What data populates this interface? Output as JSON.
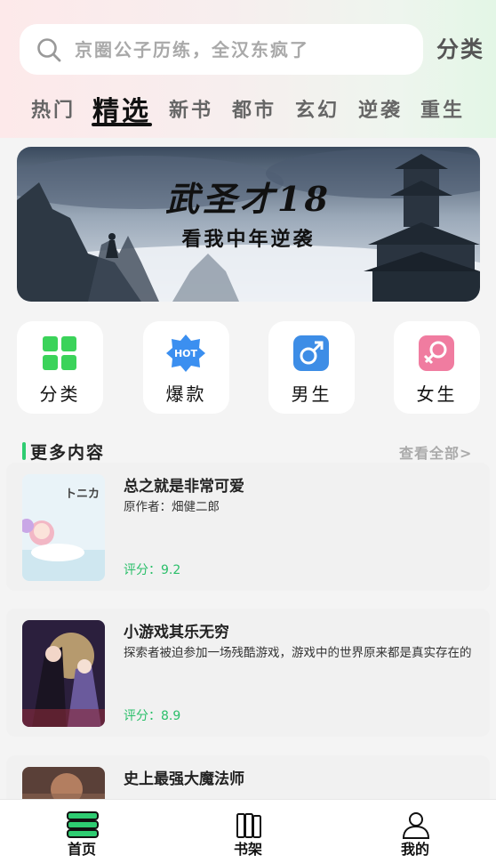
{
  "search": {
    "placeholder": "京圈公子历练，全汉东疯了",
    "category_label": "分类"
  },
  "tabs": [
    {
      "label": "热门"
    },
    {
      "label": "精选"
    },
    {
      "label": "新书"
    },
    {
      "label": "都市"
    },
    {
      "label": "玄幻"
    },
    {
      "label": "逆袭"
    },
    {
      "label": "重生"
    }
  ],
  "banner": {
    "title": "武圣才18",
    "subtitle": "看我中年逆袭"
  },
  "quick_links": [
    {
      "label": "分类",
      "icon": "grid-icon",
      "color": "#3bd35a"
    },
    {
      "label": "爆款",
      "icon": "hot-badge-icon",
      "badge": "HOT",
      "color": "#3b8ff0"
    },
    {
      "label": "男生",
      "icon": "male-icon",
      "color": "#3d8de6"
    },
    {
      "label": "女生",
      "icon": "female-icon",
      "color": "#f07ca0"
    }
  ],
  "section": {
    "title": "更多内容",
    "view_all": "查看全部>"
  },
  "books": [
    {
      "title": "总之就是非常可爱",
      "desc": "原作者：畑健二郎",
      "rating": "评分：9.2"
    },
    {
      "title": "小游戏其乐无穷",
      "desc": "探索者被迫参加一场残酷游戏，游戏中的世界原来都是真实存在的",
      "rating": "评分：8.9"
    },
    {
      "title": "史上最强大魔法师",
      "desc": "",
      "rating": ""
    }
  ],
  "bottom_nav": [
    {
      "label": "首页",
      "icon": "home-books-icon",
      "active": true
    },
    {
      "label": "书架",
      "icon": "bookshelf-icon",
      "active": false
    },
    {
      "label": "我的",
      "icon": "user-icon",
      "active": false
    }
  ],
  "colors": {
    "accent": "#2ecc71",
    "rating": "#2bbf6a"
  }
}
